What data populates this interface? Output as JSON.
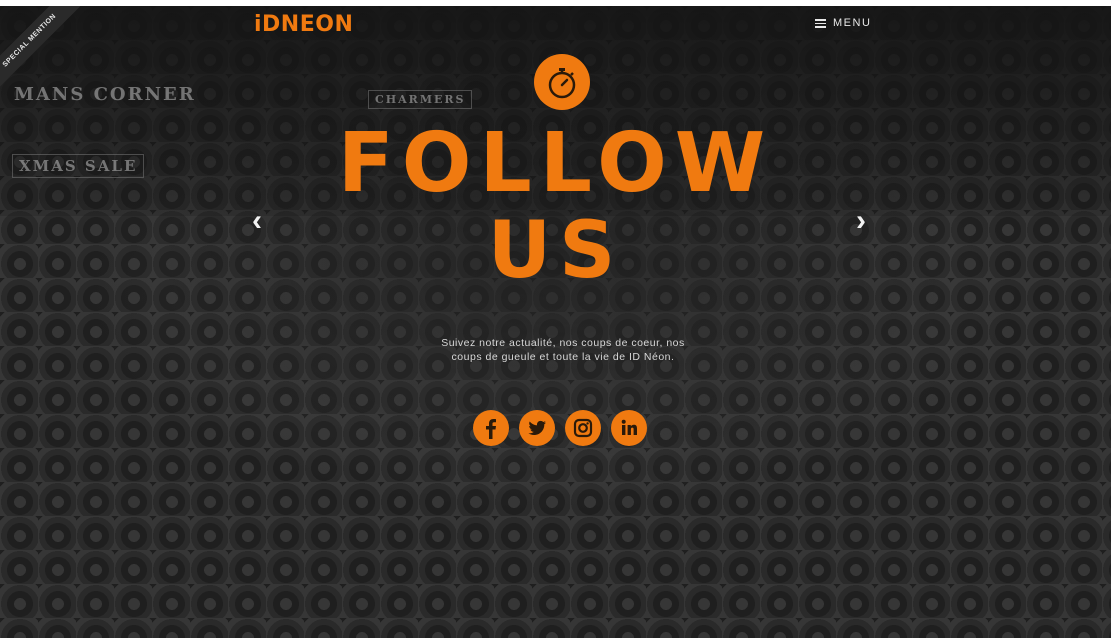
{
  "header": {
    "logo_text": "iDNEON",
    "menu_label": "MENU",
    "ribbon_text": "SPECIAL MENTION"
  },
  "background": {
    "signs": [
      "MANS CORNER",
      "XMAS SALE",
      "CHARMERS"
    ]
  },
  "hero": {
    "icon": "stopwatch-icon",
    "title_line_1": "FOLLOW",
    "title_line_2": "US",
    "description": "Suivez notre actualité, nos coups de coeur, nos coups de gueule et toute la vie de ID Néon.",
    "prev_arrow": "‹",
    "next_arrow": "›"
  },
  "socials": [
    {
      "icon": "facebook-icon",
      "label": "f"
    },
    {
      "icon": "twitter-icon",
      "label": "twitter"
    },
    {
      "icon": "instagram-icon",
      "label": "instagram"
    },
    {
      "icon": "linkedin-icon",
      "label": "in"
    }
  ],
  "colors": {
    "accent": "#f07a10",
    "text_light": "#e8e8e8",
    "background": "#1a1a1a"
  }
}
